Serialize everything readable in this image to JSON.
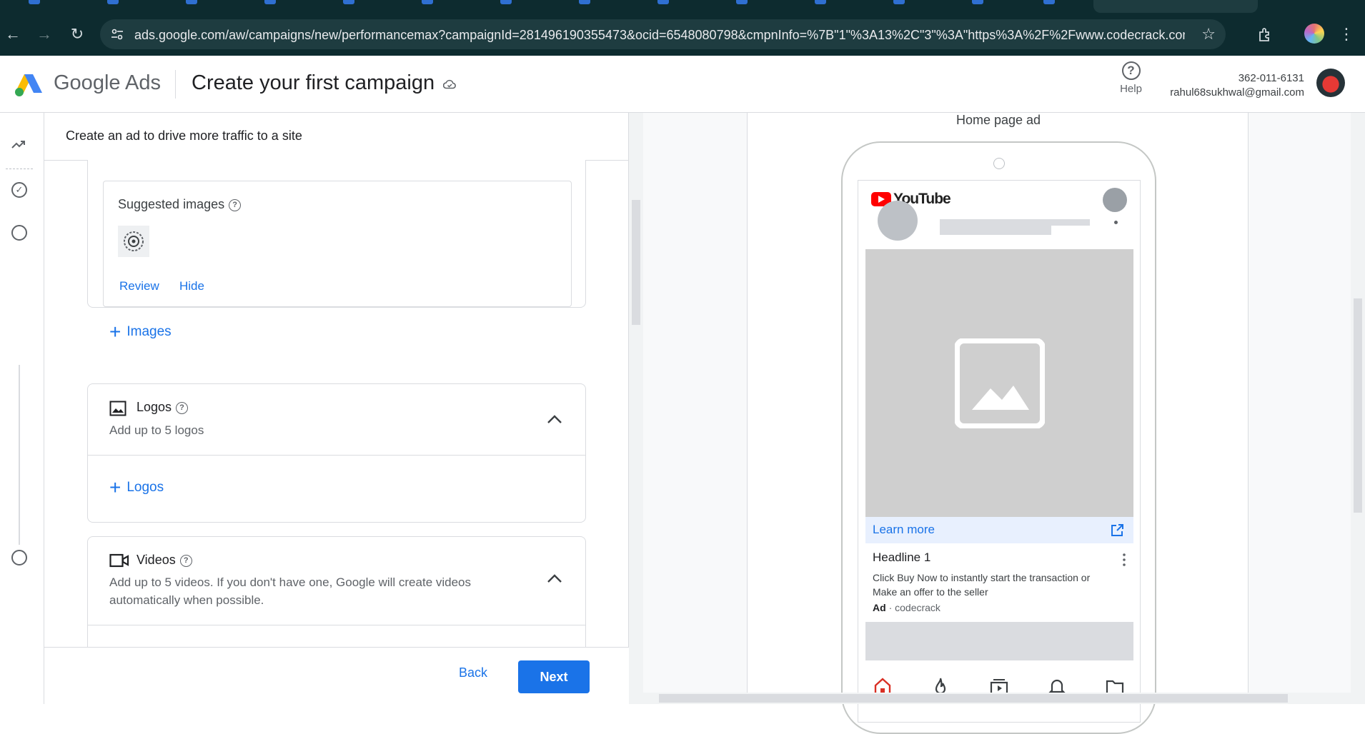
{
  "browser": {
    "url": "ads.google.com/aw/campaigns/new/performancemax?campaignId=281496190355473&ocid=6548080798&cmpnInfo=%7B\"1\"%3A13%2C\"3\"%3A\"https%3A%2F%2Fwww.codecrack.com\"%2C\"4..."
  },
  "header": {
    "brand": "Google Ads",
    "title": "Create your first campaign",
    "help_label": "Help",
    "account_id": "362-011-6131",
    "account_email": "rahul68sukhwal@gmail.com"
  },
  "editor": {
    "heading": "Create an ad to drive more traffic to a site",
    "suggested_images": {
      "title": "Suggested images",
      "review": "Review",
      "hide": "Hide"
    },
    "add_images": "Images",
    "logos": {
      "title": "Logos",
      "subtitle": "Add up to 5 logos",
      "add": "Logos"
    },
    "videos": {
      "title": "Videos",
      "subtitle": "Add up to 5 videos. If you don't have one, Google will create videos automatically when possible."
    },
    "back": "Back",
    "next": "Next"
  },
  "preview": {
    "label": "Home page ad",
    "app_name": "YouTube",
    "cta": "Learn more",
    "headline": "Headline 1",
    "description": "Click Buy Now to instantly start the transaction or Make an offer to the seller",
    "ad_badge": "Ad",
    "separator": "·",
    "advertiser": "codecrack"
  },
  "colors": {
    "accent": "#1a73e8",
    "chrome_bg": "#0d2b2f",
    "youtube_red": "#ff0000"
  }
}
